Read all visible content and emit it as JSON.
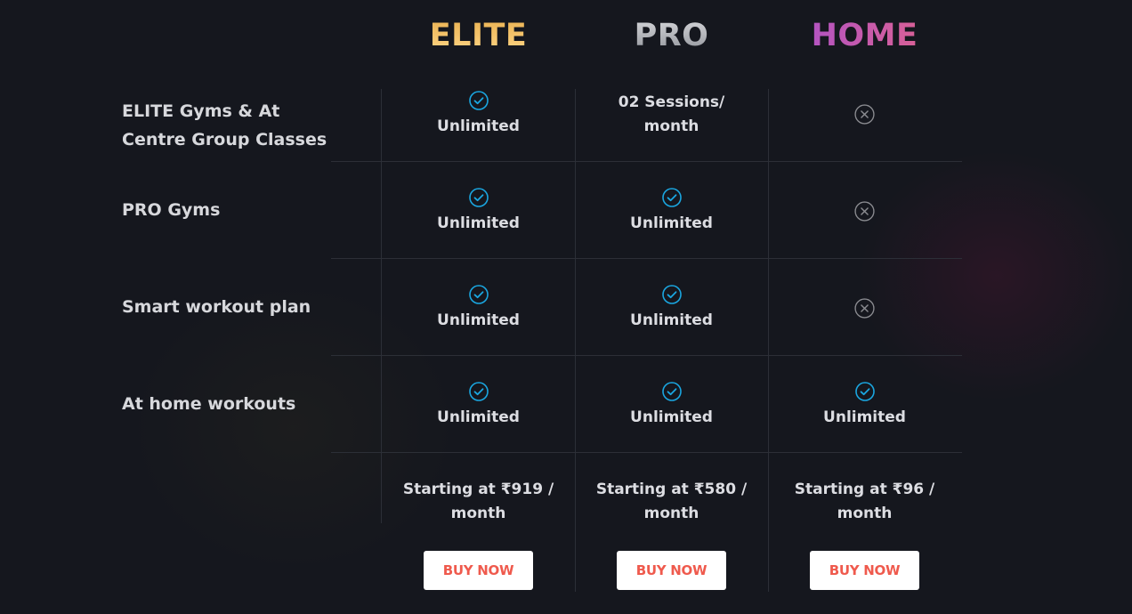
{
  "plans": [
    {
      "id": "elite",
      "name": "ELITE",
      "price_line1": "Starting at ₹919 /",
      "price_line2": "month",
      "button": "BUY NOW"
    },
    {
      "id": "pro",
      "name": "PRO",
      "price_line1": "Starting at ₹580 /",
      "price_line2": "month",
      "button": "BUY NOW"
    },
    {
      "id": "home",
      "name": "HOME",
      "price_line1": "Starting at ₹96 /",
      "price_line2": "month",
      "button": "BUY NOW"
    }
  ],
  "features": [
    {
      "label": "ELITE Gyms & At Centre Group Classes",
      "cells": [
        {
          "icon": "check-circle-icon",
          "text": "Unlimited"
        },
        {
          "icon": "",
          "text": "02 Sessions/ month"
        },
        {
          "icon": "x-circle-icon",
          "text": ""
        }
      ]
    },
    {
      "label": "PRO Gyms",
      "cells": [
        {
          "icon": "check-circle-icon",
          "text": "Unlimited"
        },
        {
          "icon": "check-circle-icon",
          "text": "Unlimited"
        },
        {
          "icon": "x-circle-icon",
          "text": ""
        }
      ]
    },
    {
      "label": "Smart workout plan",
      "cells": [
        {
          "icon": "check-circle-icon",
          "text": "Unlimited"
        },
        {
          "icon": "check-circle-icon",
          "text": "Unlimited"
        },
        {
          "icon": "x-circle-icon",
          "text": ""
        }
      ]
    },
    {
      "label": "At home workouts",
      "cells": [
        {
          "icon": "check-circle-icon",
          "text": "Unlimited"
        },
        {
          "icon": "check-circle-icon",
          "text": "Unlimited"
        },
        {
          "icon": "check-circle-icon",
          "text": "Unlimited"
        }
      ]
    }
  ],
  "colors": {
    "background": "#15171e",
    "check": "#1aa6e0",
    "cross": "#8a8b90",
    "elite": "#f3c56f",
    "pro": "#b9bbc2",
    "home_start": "#a54fd1",
    "home_end": "#e66587",
    "button_text": "#ef5a4d"
  }
}
